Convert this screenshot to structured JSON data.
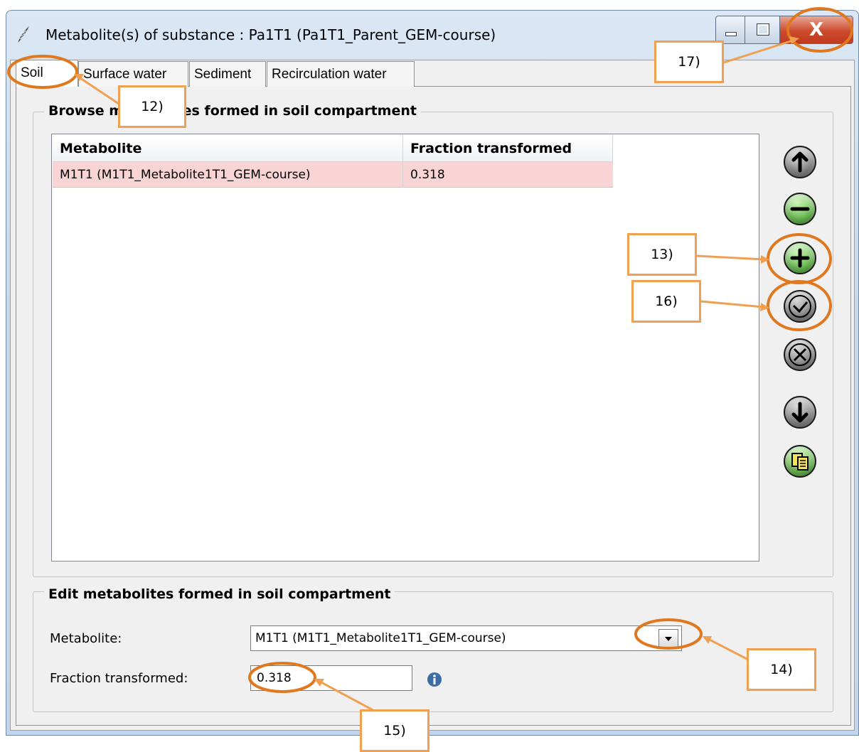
{
  "window": {
    "title": "Metabolite(s) of substance : Pa1T1 (Pa1T1_Parent_GEM-course)",
    "close_glyph": "X"
  },
  "tabs": [
    {
      "label": "Soil",
      "active": true
    },
    {
      "label": "Surface water",
      "active": false
    },
    {
      "label": "Sediment",
      "active": false
    },
    {
      "label": "Recirculation water",
      "active": false
    }
  ],
  "browse": {
    "title": "Browse metabolites formed in soil compartment",
    "columns": [
      "Metabolite",
      "Fraction transformed"
    ],
    "rows": [
      {
        "metabolite": "M1T1 (M1T1_Metabolite1T1_GEM-course)",
        "fraction": "0.318"
      }
    ],
    "row_highlight_color": "#f8d4d4"
  },
  "side_buttons": [
    {
      "name": "move-up-button",
      "icon": "arrow-up-icon"
    },
    {
      "name": "remove-button",
      "icon": "minus-icon"
    },
    {
      "name": "add-button",
      "icon": "plus-icon"
    },
    {
      "name": "accept-button",
      "icon": "check-icon"
    },
    {
      "name": "cancel-button",
      "icon": "x-icon"
    },
    {
      "name": "move-down-button",
      "icon": "arrow-down-icon"
    },
    {
      "name": "copy-button",
      "icon": "copy-icon"
    }
  ],
  "edit": {
    "title": "Edit metabolites formed in soil compartment",
    "metabolite_label": "Metabolite:",
    "metabolite_value": "M1T1 (M1T1_Metabolite1T1_GEM-course)",
    "fraction_label": "Fraction transformed:",
    "fraction_value": "0.318"
  },
  "annotations": {
    "c12": "12)",
    "c13": "13)",
    "c14": "14)",
    "c15": "15)",
    "c16": "16)",
    "c17": "17)",
    "color": "#f0a050",
    "ring_color": "#e07820"
  }
}
